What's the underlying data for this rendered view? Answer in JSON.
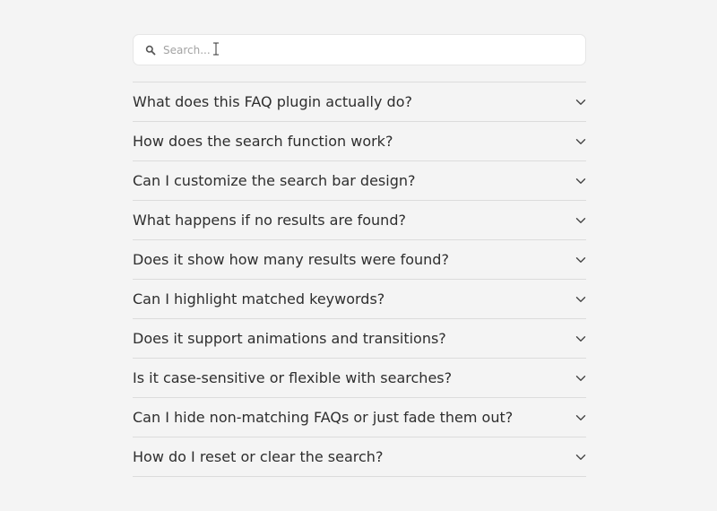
{
  "search": {
    "placeholder": "Search...",
    "value": ""
  },
  "faq": {
    "items": [
      {
        "question": "What does this FAQ plugin actually do?"
      },
      {
        "question": "How does the search function work?"
      },
      {
        "question": "Can I customize the search bar design?"
      },
      {
        "question": "What happens if no results are found?"
      },
      {
        "question": "Does it show how many results were found?"
      },
      {
        "question": "Can I highlight matched keywords?"
      },
      {
        "question": "Does it support animations and transitions?"
      },
      {
        "question": "Is it case-sensitive or flexible with searches?"
      },
      {
        "question": "Can I hide non-matching FAQs or just fade them out?"
      },
      {
        "question": "How do I reset or clear the search?"
      }
    ]
  },
  "icons": {
    "search": "search-icon",
    "chevron": "chevron-down-icon",
    "cursor": "text-cursor-icon"
  },
  "colors": {
    "background": "#f4f4f4",
    "divider": "#dcdcdc",
    "text": "#2e2e2e",
    "placeholder": "#a3a3a3"
  }
}
